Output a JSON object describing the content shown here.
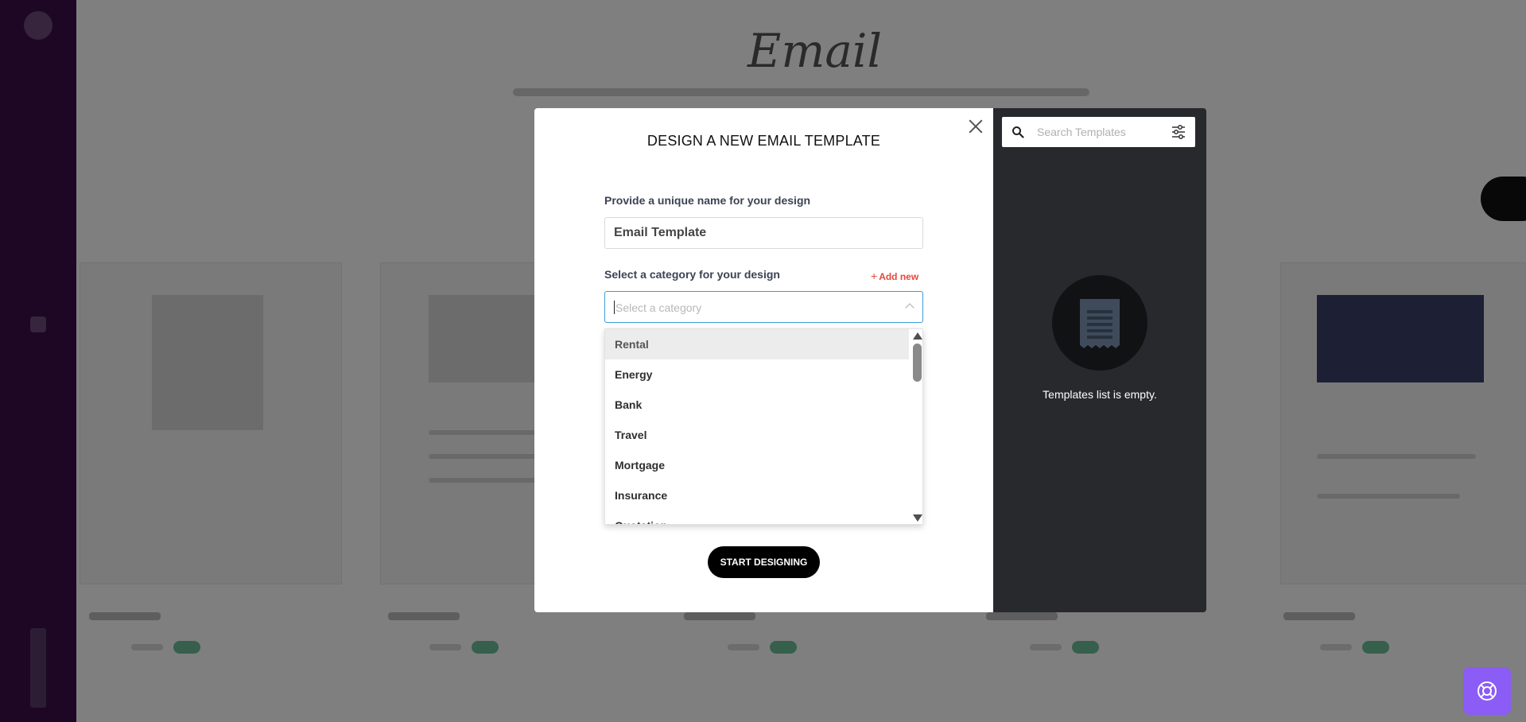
{
  "background": {
    "page_title": "Email"
  },
  "modal": {
    "title": "DESIGN A NEW EMAIL TEMPLATE",
    "name_label": "Provide a unique name for your design",
    "name_value": "Email Template",
    "category_label": "Select a category for your design",
    "add_new_label": "Add new",
    "category_placeholder": "Select a category",
    "category_options": [
      "Rental",
      "Energy",
      "Bank",
      "Travel",
      "Mortgage",
      "Insurance",
      "Quotation"
    ],
    "highlighted_option": "Rental",
    "start_button_label": "START DESIGNING"
  },
  "templates_panel": {
    "search_placeholder": "Search Templates",
    "empty_message": "Templates list is empty."
  },
  "colors": {
    "sidebar": "#3a0f4a",
    "accent_add_new": "#e5483b",
    "input_focus_border": "#3b9bd6",
    "templates_panel_bg": "#27292d",
    "help_button": "#8b5cf6"
  },
  "icons": [
    "close-icon",
    "plus-icon",
    "chevron-up-icon",
    "search-icon",
    "filter-icon",
    "document-icon",
    "lifebuoy-icon"
  ]
}
